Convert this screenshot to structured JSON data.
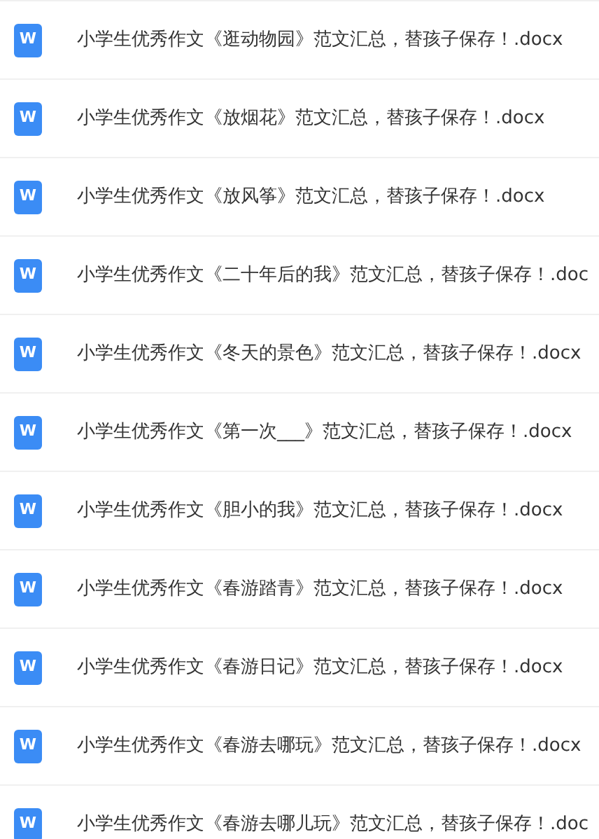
{
  "files": [
    {
      "icon_label": "W",
      "name": "小学生优秀作文《逛动物园》范文汇总，替孩子保存！.docx"
    },
    {
      "icon_label": "W",
      "name": "小学生优秀作文《放烟花》范文汇总，替孩子保存！.docx"
    },
    {
      "icon_label": "W",
      "name": "小学生优秀作文《放风筝》范文汇总，替孩子保存！.docx"
    },
    {
      "icon_label": "W",
      "name": "小学生优秀作文《二十年后的我》范文汇总，替孩子保存！.doc"
    },
    {
      "icon_label": "W",
      "name": "小学生优秀作文《冬天的景色》范文汇总，替孩子保存！.docx"
    },
    {
      "icon_label": "W",
      "name": "小学生优秀作文《第一次___》范文汇总，替孩子保存！.docx"
    },
    {
      "icon_label": "W",
      "name": "小学生优秀作文《胆小的我》范文汇总，替孩子保存！.docx"
    },
    {
      "icon_label": "W",
      "name": "小学生优秀作文《春游踏青》范文汇总，替孩子保存！.docx"
    },
    {
      "icon_label": "W",
      "name": "小学生优秀作文《春游日记》范文汇总，替孩子保存！.docx"
    },
    {
      "icon_label": "W",
      "name": "小学生优秀作文《春游去哪玩》范文汇总，替孩子保存！.docx"
    },
    {
      "icon_label": "W",
      "name": "小学生优秀作文《春游去哪儿玩》范文汇总，替孩子保存！.doc"
    }
  ]
}
